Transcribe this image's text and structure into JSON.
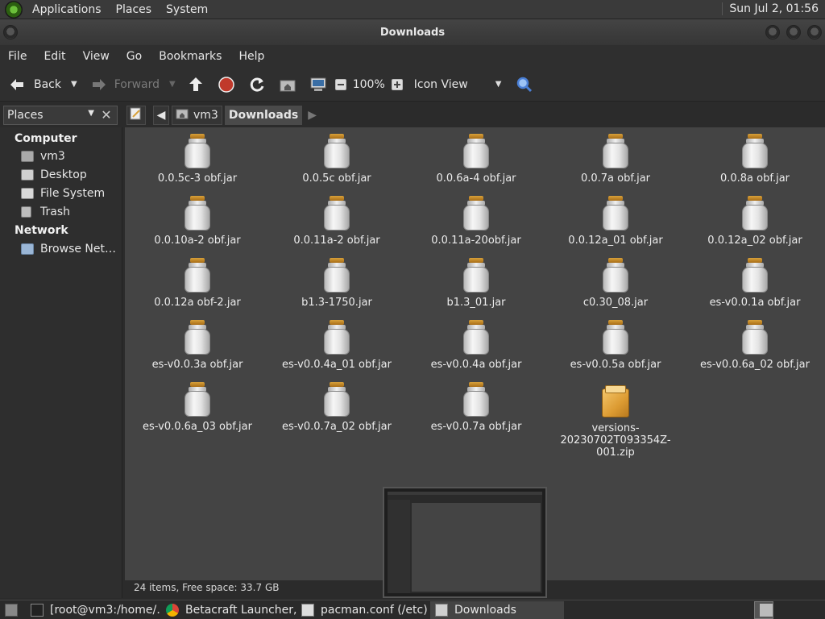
{
  "top_panel": {
    "menus": [
      "Applications",
      "Places",
      "System"
    ],
    "clock": "Sun Jul  2, 01:56"
  },
  "window": {
    "title": "Downloads"
  },
  "menubar": [
    "File",
    "Edit",
    "View",
    "Go",
    "Bookmarks",
    "Help"
  ],
  "toolbar": {
    "back": "Back",
    "forward": "Forward",
    "zoom": "100%",
    "view_mode": "Icon View"
  },
  "sidebar": {
    "selector": "Places",
    "sections": [
      {
        "header": "Computer",
        "items": [
          "vm3",
          "Desktop",
          "File System",
          "Trash"
        ]
      },
      {
        "header": "Network",
        "items": [
          "Browse Net…"
        ]
      }
    ]
  },
  "location": {
    "crumbs": [
      "vm3",
      "Downloads"
    ]
  },
  "files": [
    "0.0.5c-3 obf.jar",
    "0.0.5c obf.jar",
    "0.0.6a-4 obf.jar",
    "0.0.7a obf.jar",
    "0.0.8a obf.jar",
    "0.0.10a-2 obf.jar",
    "0.0.11a-2 obf.jar",
    "0.0.11a-20obf.jar",
    "0.0.12a_01 obf.jar",
    "0.0.12a_02 obf.jar",
    "0.0.12a obf-2.jar",
    "b1.3-1750.jar",
    "b1.3_01.jar",
    "c0.30_08.jar",
    "es-v0.0.1a obf.jar",
    "es-v0.0.3a obf.jar",
    "es-v0.0.4a_01 obf.jar",
    "es-v0.0.4a obf.jar",
    "es-v0.0.5a obf.jar",
    "es-v0.0.6a_02 obf.jar",
    "es-v0.0.6a_03 obf.jar",
    "es-v0.0.7a_02 obf.jar",
    "es-v0.0.7a obf.jar"
  ],
  "zip_file": {
    "line1": "versions-",
    "line2": "20230702T093354Z-",
    "line3": "001.zip"
  },
  "status": "24 items, Free space: 33.7 GB",
  "taskbar": {
    "tasks": [
      "[root@vm3:/home/…",
      "Betacraft Launcher, J…",
      "pacman.conf (/etc) - …",
      "Downloads"
    ]
  },
  "colors": {
    "accent_orange": "#d8a13a",
    "stop_red": "#c0392b",
    "search_blue": "#4a7fd6"
  }
}
